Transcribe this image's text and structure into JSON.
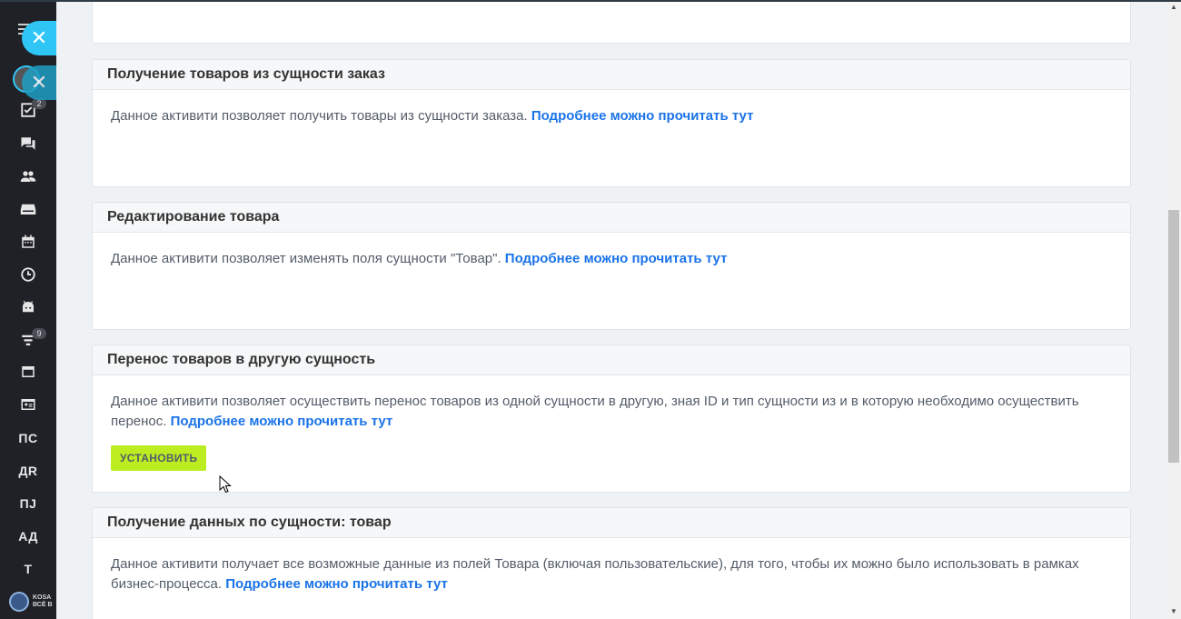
{
  "sidebar": {
    "badges": {
      "tasks": "2",
      "funnel": "9"
    },
    "text_items": [
      "ПС",
      "ДR",
      "ПJ",
      "АД",
      "Т"
    ],
    "logo_text": [
      "KOSA",
      "ВСЁ В"
    ]
  },
  "cards": [
    {
      "title": "",
      "body": "",
      "link": ""
    },
    {
      "title": "Получение товаров из сущности заказ",
      "body": "Данное активити позволяет получить товары из сущности заказа.",
      "link": "Подробнее можно прочитать тут"
    },
    {
      "title": "Редактирование товара",
      "body": "Данное активити позволяет изменять поля сущности \"Товар\".",
      "link": "Подробнее можно прочитать тут"
    },
    {
      "title": "Перенос товаров в другую сущность",
      "body": "Данное активити позволяет осуществить перенос товаров из одной сущности в другую, зная ID и тип сущности из и в которую необходимо осуществить перенос.",
      "link": "Подробнее можно прочитать тут",
      "button": "УСТАНОВИТЬ"
    },
    {
      "title": "Получение данных по сущности: товар",
      "body": "Данное активити получает все возможные данные из полей Товара (включая пользовательские), для того, чтобы их можно было использовать в рамках бизнес-процесса.",
      "link": "Подробнее можно прочитать тут"
    }
  ],
  "colors": {
    "sidebar_bg": "#1f2127",
    "accent": "#2fc6f6",
    "link": "#1a73e8",
    "button": "#bbed21"
  }
}
